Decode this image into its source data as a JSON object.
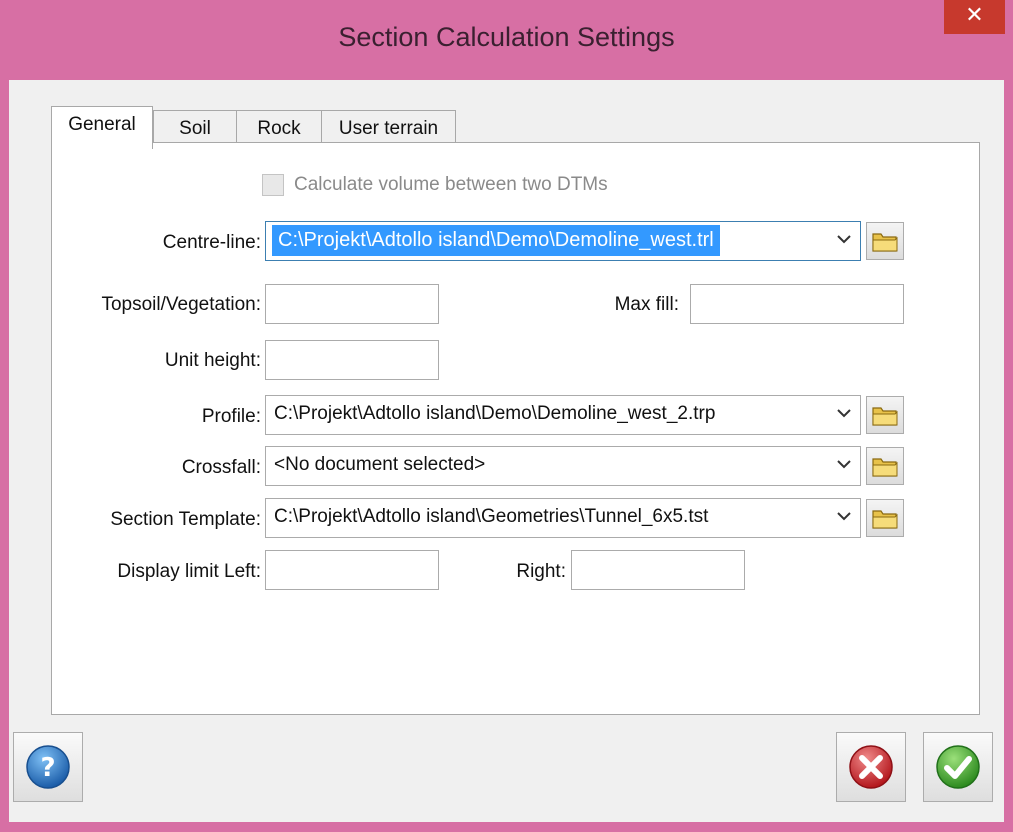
{
  "window": {
    "title": "Section Calculation Settings",
    "close_glyph": "✕"
  },
  "tabs": [
    {
      "label": "General",
      "active": true
    },
    {
      "label": "Soil",
      "active": false
    },
    {
      "label": "Rock",
      "active": false
    },
    {
      "label": "User terrain",
      "active": false
    }
  ],
  "general": {
    "calc_volume_label": "Calculate volume between two DTMs",
    "calc_volume_checked": false,
    "centre_line": {
      "label": "Centre-line:",
      "value": "C:\\Projekt\\Adtollo island\\Demo\\Demoline_west.trl"
    },
    "topsoil": {
      "label": "Topsoil/Vegetation:",
      "value": ""
    },
    "max_fill": {
      "label": "Max fill:",
      "value": ""
    },
    "unit_height": {
      "label": "Unit height:",
      "value": ""
    },
    "profile": {
      "label": "Profile:",
      "value": "C:\\Projekt\\Adtollo island\\Demo\\Demoline_west_2.trp"
    },
    "crossfall": {
      "label": "Crossfall:",
      "value": "<No document selected>"
    },
    "section_template": {
      "label": "Section Template:",
      "value": "C:\\Projekt\\Adtollo island\\Geometries\\Tunnel_6x5.tst"
    },
    "display_limit_left": {
      "label": "Display limit Left:",
      "value": ""
    },
    "display_limit_right": {
      "label": "Right:",
      "value": ""
    }
  },
  "footer": {
    "help_icon": "help-icon",
    "cancel_icon": "cancel-icon",
    "ok_icon": "ok-checkmark-icon"
  },
  "colors": {
    "title_bar": "#d76fa4",
    "close_button": "#c7392d",
    "selection": "#3399ff"
  }
}
